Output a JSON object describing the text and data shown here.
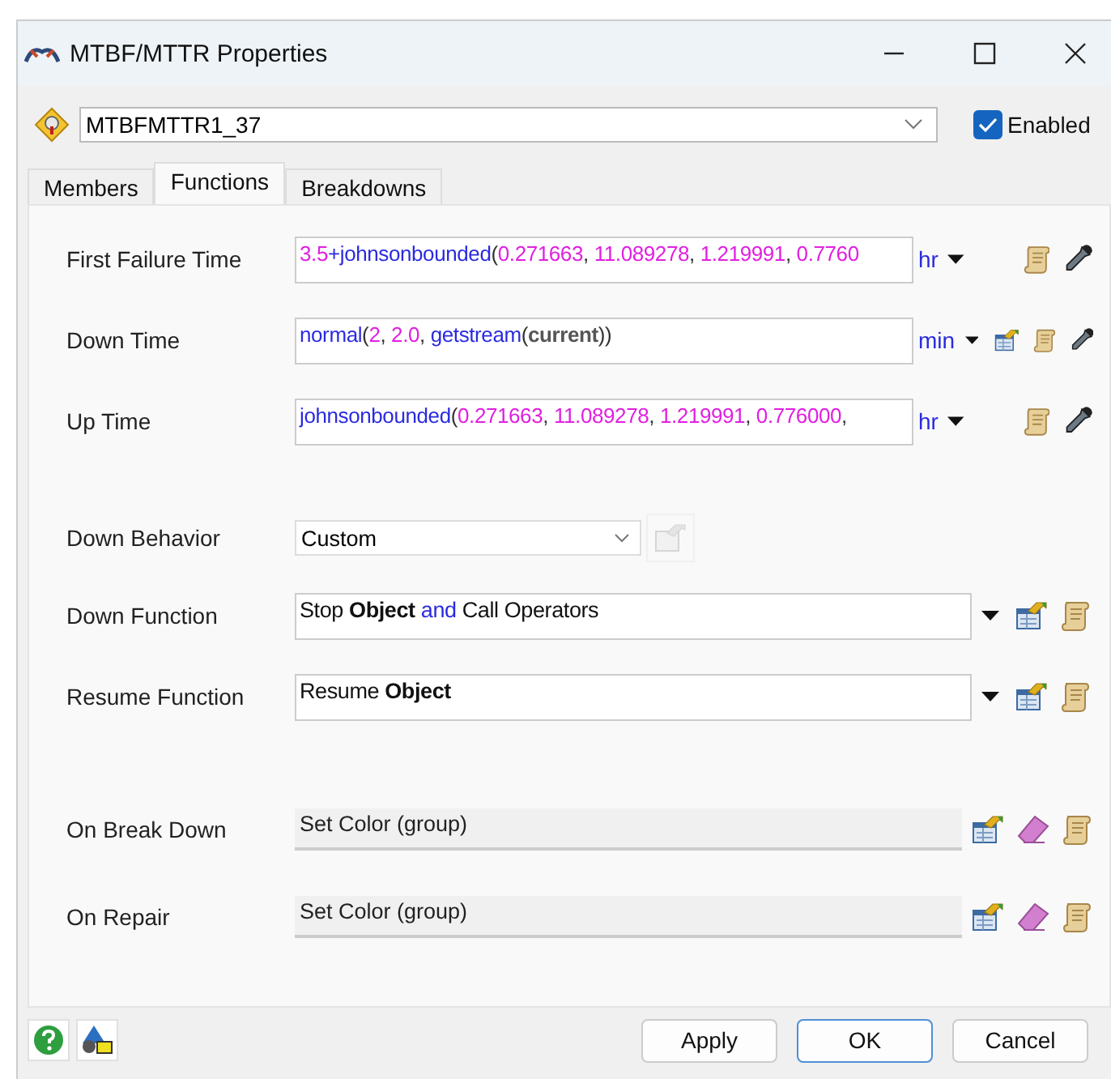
{
  "window": {
    "title": "MTBF/MTTR Properties"
  },
  "object": {
    "value": "MTBFMTTR1_37",
    "enabled": true,
    "enabled_label": "Enabled"
  },
  "tabs": [
    {
      "label": "Members",
      "selected": false
    },
    {
      "label": "Functions",
      "selected": true
    },
    {
      "label": "Breakdowns",
      "selected": false
    }
  ],
  "time_fields": [
    {
      "label": "First Failure Time",
      "unit": "hr",
      "has_template": false,
      "tokens": [
        {
          "kind": "number",
          "text": "3.5"
        },
        {
          "kind": "function",
          "text": "+johnsonbounded"
        },
        {
          "kind": "punct",
          "text": "("
        },
        {
          "kind": "number",
          "text": "0.271663"
        },
        {
          "kind": "punct",
          "text": ", "
        },
        {
          "kind": "number",
          "text": "11.089278"
        },
        {
          "kind": "punct",
          "text": ", "
        },
        {
          "kind": "number",
          "text": "1.219991"
        },
        {
          "kind": "punct",
          "text": ", "
        },
        {
          "kind": "number",
          "text": "0.7760"
        }
      ]
    },
    {
      "label": "Down Time",
      "unit": "min",
      "has_template": true,
      "tokens": [
        {
          "kind": "function",
          "text": "normal"
        },
        {
          "kind": "punct",
          "text": "("
        },
        {
          "kind": "number",
          "text": "2"
        },
        {
          "kind": "punct",
          "text": ", "
        },
        {
          "kind": "number",
          "text": "2.0"
        },
        {
          "kind": "punct",
          "text": ", "
        },
        {
          "kind": "function",
          "text": "getstream"
        },
        {
          "kind": "punct",
          "text": "("
        },
        {
          "kind": "variable",
          "text": "current"
        },
        {
          "kind": "punct",
          "text": "))"
        }
      ]
    },
    {
      "label": "Up Time",
      "unit": "hr",
      "has_template": false,
      "tokens": [
        {
          "kind": "function",
          "text": "johnsonbounded"
        },
        {
          "kind": "punct",
          "text": "("
        },
        {
          "kind": "number",
          "text": "0.271663"
        },
        {
          "kind": "punct",
          "text": ", "
        },
        {
          "kind": "number",
          "text": "11.089278"
        },
        {
          "kind": "punct",
          "text": ", "
        },
        {
          "kind": "number",
          "text": "1.219991"
        },
        {
          "kind": "punct",
          "text": ", "
        },
        {
          "kind": "number",
          "text": "0.776000"
        },
        {
          "kind": "punct",
          "text": ","
        }
      ]
    }
  ],
  "down_behavior": {
    "label": "Down Behavior",
    "value": "Custom",
    "template_disabled": true
  },
  "function_fields": [
    {
      "label": "Down Function",
      "tokens": [
        {
          "kind": "text",
          "text": "Stop "
        },
        {
          "kind": "bold",
          "text": "Object"
        },
        {
          "kind": "keyword",
          "text": " and "
        },
        {
          "kind": "text",
          "text": "Call Operators"
        }
      ]
    },
    {
      "label": "Resume Function",
      "tokens": [
        {
          "kind": "text",
          "text": "Resume "
        },
        {
          "kind": "bold",
          "text": "Object"
        }
      ]
    }
  ],
  "triggers": [
    {
      "label": "On Break Down",
      "value": "Set Color (group)"
    },
    {
      "label": "On Repair",
      "value": "Set Color (group)"
    }
  ],
  "buttons": [
    {
      "label": "Apply",
      "default": false
    },
    {
      "label": "OK",
      "default": true
    },
    {
      "label": "Cancel",
      "default": false
    }
  ]
}
